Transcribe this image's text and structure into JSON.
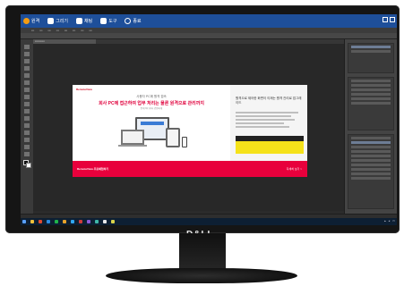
{
  "overlay": {
    "items": [
      {
        "label": "원격",
        "icon": "remote-icon"
      },
      {
        "label": "그리기",
        "icon": "pen-icon"
      },
      {
        "label": "채팅",
        "icon": "chat-icon"
      },
      {
        "label": "도구",
        "icon": "tools-icon"
      },
      {
        "label": "종료",
        "icon": "power-icon"
      }
    ]
  },
  "banner": {
    "logo": "RemoteView",
    "headline_top": "사용자 PC에 원격 접속",
    "headline_main": "회사 PC에 접근하여 업무 처리는 물론 원격으로 관리까지",
    "headline_sub": "언제 어디서나 간편하게",
    "right_title": "원격으로 제어한 화면이 이제는 원격 관리로 업그레이드",
    "bottom_text": "RemoteView 무료체험하기",
    "bottom_link": "자세히 보기 >"
  },
  "monitor": {
    "brand": "D&LL"
  },
  "colors": {
    "accent": "#e8003c",
    "overlay": "#1e4f9a",
    "yellow": "#f5e21a"
  }
}
